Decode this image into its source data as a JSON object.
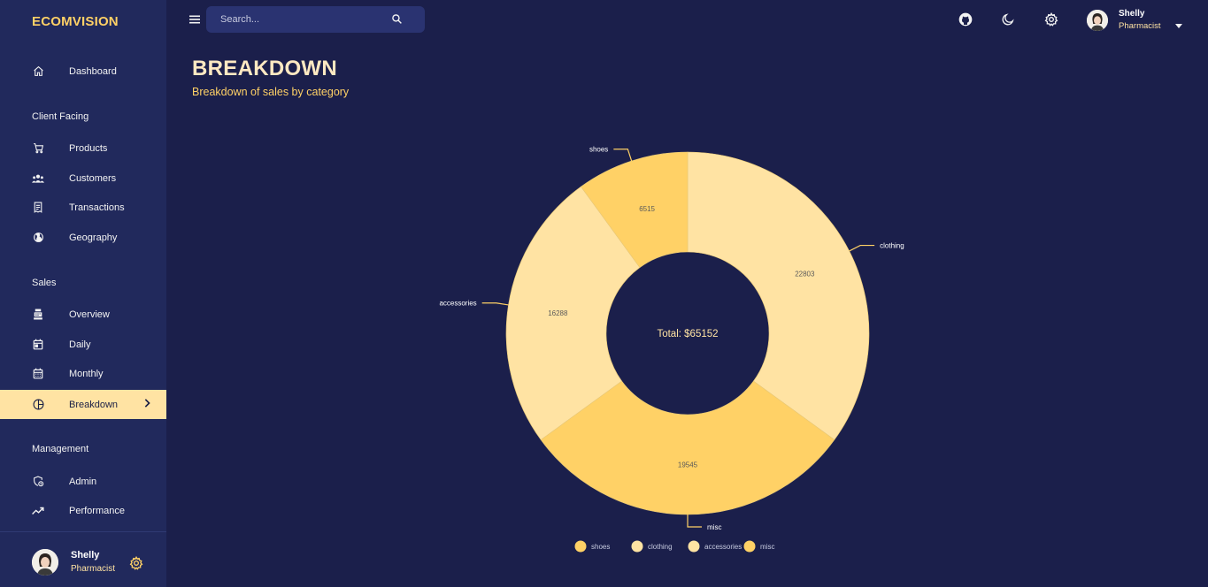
{
  "app": {
    "brand": "ECOMVISION"
  },
  "sidebar": {
    "items": [
      {
        "label": "Dashboard",
        "icon": "home-icon"
      },
      {
        "label": "Products",
        "icon": "cart-icon"
      },
      {
        "label": "Customers",
        "icon": "people-icon"
      },
      {
        "label": "Transactions",
        "icon": "receipt-icon"
      },
      {
        "label": "Geography",
        "icon": "globe-icon"
      },
      {
        "label": "Overview",
        "icon": "point-of-sale-icon"
      },
      {
        "label": "Daily",
        "icon": "calendar-today-icon"
      },
      {
        "label": "Monthly",
        "icon": "calendar-month-icon"
      },
      {
        "label": "Breakdown",
        "icon": "pie-chart-icon",
        "active": true
      },
      {
        "label": "Admin",
        "icon": "admin-icon"
      },
      {
        "label": "Performance",
        "icon": "trending-up-icon"
      }
    ],
    "sections": [
      "Client Facing",
      "Sales",
      "Management"
    ],
    "footer": {
      "name": "Shelly",
      "role": "Pharmacist"
    }
  },
  "topbar": {
    "search_placeholder": "Search...",
    "user": {
      "name": "Shelly",
      "role": "Pharmacist"
    }
  },
  "header": {
    "title": "BREAKDOWN",
    "subtitle": "Breakdown of sales by category"
  },
  "colors": {
    "background": "#1b1f4b",
    "sidebar": "#21295c",
    "accent": "#ffd166",
    "slice_light": "#ffe3a3",
    "slice_dark": "#ffd166"
  },
  "chart_data": {
    "type": "pie",
    "donut": true,
    "center_label": "Total: $65152",
    "categories": [
      "shoes",
      "clothing",
      "accessories",
      "misc"
    ],
    "values": [
      6515,
      22803,
      16288,
      19545
    ],
    "colors": [
      "#ffd166",
      "#ffe3a3",
      "#ffe3a3",
      "#ffd166"
    ],
    "legend": [
      "shoes",
      "clothing",
      "accessories",
      "misc"
    ],
    "legend_position": "bottom"
  }
}
